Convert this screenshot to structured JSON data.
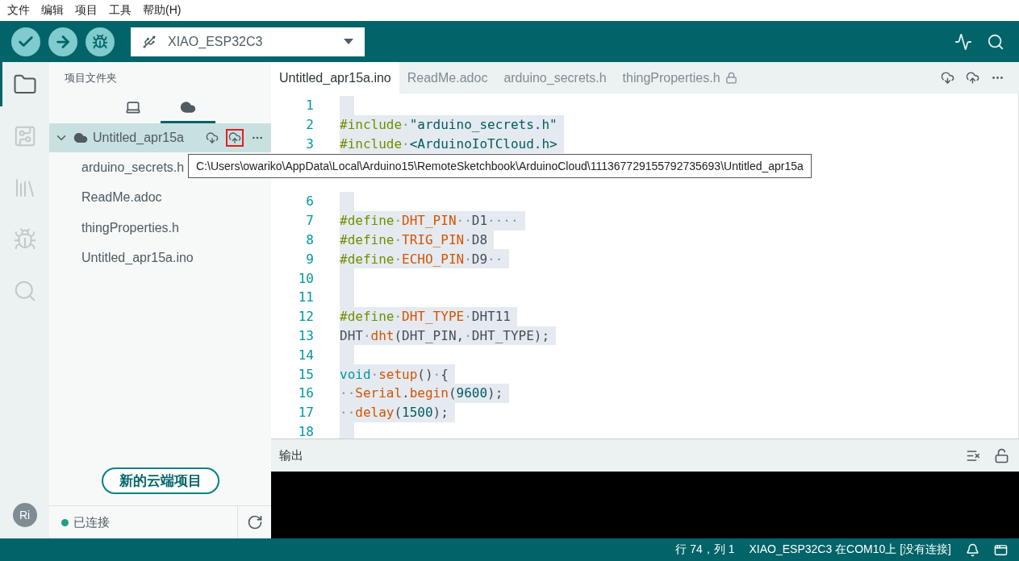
{
  "menu": [
    "文件",
    "编辑",
    "项目",
    "工具",
    "帮助(H)"
  ],
  "toolbar": {
    "board": "XIAO_ESP32C3"
  },
  "activity_bar": {
    "items": [
      {
        "kind": "sketchbook",
        "selected": true
      },
      {
        "kind": "boards",
        "selected": false
      },
      {
        "kind": "library",
        "selected": false
      },
      {
        "kind": "debug",
        "selected": false
      },
      {
        "kind": "search",
        "selected": false
      }
    ],
    "avatar": "Ri"
  },
  "sidebar": {
    "title": "项目文件夹",
    "view_tabs": [
      {
        "kind": "local",
        "selected": false
      },
      {
        "kind": "cloud",
        "selected": true
      }
    ],
    "tree": {
      "name": "Untitled_apr15a",
      "expanded": true,
      "selected": true,
      "actions": [
        {
          "kind": "download",
          "highlighted": false
        },
        {
          "kind": "upload",
          "highlighted": true
        },
        {
          "kind": "more",
          "highlighted": false
        }
      ],
      "children": [
        {
          "name": "arduino_secrets.h"
        },
        {
          "name": "ReadMe.adoc"
        },
        {
          "name": "thingProperties.h"
        },
        {
          "name": "Untitled_apr15a.ino"
        }
      ]
    },
    "new_button": "新的云端项目",
    "connection": {
      "label": "已连接",
      "connected": true
    }
  },
  "tooltip": "C:\\Users\\owariko\\AppData\\Local\\Arduino15\\RemoteSketchbook\\ArduinoCloud\\111367729155792735693\\Untitled_apr15a",
  "editor": {
    "tabs": [
      {
        "label": "Untitled_apr15a.ino",
        "selected": true,
        "locked": false
      },
      {
        "label": "ReadMe.adoc",
        "selected": false,
        "locked": false
      },
      {
        "label": "arduino_secrets.h",
        "selected": false,
        "locked": false
      },
      {
        "label": "thingProperties.h",
        "selected": false,
        "locked": true
      }
    ],
    "lines": [
      {
        "kind": "code",
        "number": "1"
      },
      {
        "kind": "code",
        "number": "2",
        "tokens": [
          {
            "kind": "kw",
            "s": "#include"
          },
          {
            "kind": "ws",
            "s": "·"
          },
          {
            "kind": "str",
            "s": "\"arduino_secrets.h\""
          }
        ]
      },
      {
        "kind": "code",
        "number": "3",
        "tokens": [
          {
            "kind": "kw",
            "s": "#include"
          },
          {
            "kind": "ws",
            "s": "·"
          },
          {
            "kind": "str",
            "s": "<ArduinoIoTCloud.h>"
          }
        ]
      },
      {
        "kind": "covered"
      },
      {
        "kind": "covered"
      },
      {
        "kind": "code",
        "number": "6"
      },
      {
        "kind": "code",
        "number": "7",
        "tokens": [
          {
            "kind": "kw",
            "s": "#define"
          },
          {
            "kind": "ws",
            "s": "·"
          },
          {
            "kind": "fn",
            "s": "DHT_PIN"
          },
          {
            "kind": "ws",
            "s": "··"
          },
          {
            "kind": "plain",
            "s": "D1"
          },
          {
            "kind": "ws",
            "s": "····"
          }
        ]
      },
      {
        "kind": "code",
        "number": "8",
        "tokens": [
          {
            "kind": "kw",
            "s": "#define"
          },
          {
            "kind": "ws",
            "s": "·"
          },
          {
            "kind": "fn",
            "s": "TRIG_PIN"
          },
          {
            "kind": "ws",
            "s": "·"
          },
          {
            "kind": "plain",
            "s": "D8"
          }
        ]
      },
      {
        "kind": "code",
        "number": "9",
        "tokens": [
          {
            "kind": "kw",
            "s": "#define"
          },
          {
            "kind": "ws",
            "s": "·"
          },
          {
            "kind": "fn",
            "s": "ECHO_PIN"
          },
          {
            "kind": "ws",
            "s": "·"
          },
          {
            "kind": "plain",
            "s": "D9"
          },
          {
            "kind": "ws",
            "s": "··"
          }
        ]
      },
      {
        "kind": "code",
        "number": "10"
      },
      {
        "kind": "code",
        "number": "11"
      },
      {
        "kind": "code",
        "number": "12",
        "tokens": [
          {
            "kind": "kw",
            "s": "#define"
          },
          {
            "kind": "ws",
            "s": "·"
          },
          {
            "kind": "fn",
            "s": "DHT_TYPE"
          },
          {
            "kind": "ws",
            "s": "·"
          },
          {
            "kind": "plain",
            "s": "DHT11"
          }
        ]
      },
      {
        "kind": "code",
        "number": "13",
        "tokens": [
          {
            "kind": "plain",
            "s": "DHT"
          },
          {
            "kind": "ws",
            "s": "·"
          },
          {
            "kind": "fn",
            "s": "dht"
          },
          {
            "kind": "plain",
            "s": "(DHT_PIN,"
          },
          {
            "kind": "ws",
            "s": "·"
          },
          {
            "kind": "plain",
            "s": "DHT_TYPE);"
          }
        ]
      },
      {
        "kind": "code",
        "number": "14"
      },
      {
        "kind": "code",
        "number": "15",
        "tokens": [
          {
            "kind": "type",
            "s": "void"
          },
          {
            "kind": "ws",
            "s": "·"
          },
          {
            "kind": "fn",
            "s": "setup"
          },
          {
            "kind": "plain",
            "s": "()"
          },
          {
            "kind": "ws",
            "s": "·"
          },
          {
            "kind": "plain",
            "s": "{"
          }
        ]
      },
      {
        "kind": "code",
        "number": "16",
        "tokens": [
          {
            "kind": "ws",
            "s": "··"
          },
          {
            "kind": "fn",
            "s": "Serial"
          },
          {
            "kind": "plain",
            "s": "."
          },
          {
            "kind": "fn",
            "s": "begin"
          },
          {
            "kind": "plain",
            "s": "("
          },
          {
            "kind": "num",
            "s": "9600"
          },
          {
            "kind": "plain",
            "s": ");"
          }
        ]
      },
      {
        "kind": "code",
        "number": "17",
        "tokens": [
          {
            "kind": "ws",
            "s": "··"
          },
          {
            "kind": "fn",
            "s": "delay"
          },
          {
            "kind": "plain",
            "s": "("
          },
          {
            "kind": "num",
            "s": "1500"
          },
          {
            "kind": "plain",
            "s": ");"
          }
        ]
      },
      {
        "kind": "code",
        "number": "18"
      }
    ],
    "output": {
      "title": "输出"
    }
  },
  "status_bar": {
    "position": "行 74，列 1",
    "board_port": "XIAO_ESP32C3 在COM10上 [没有连接]"
  }
}
